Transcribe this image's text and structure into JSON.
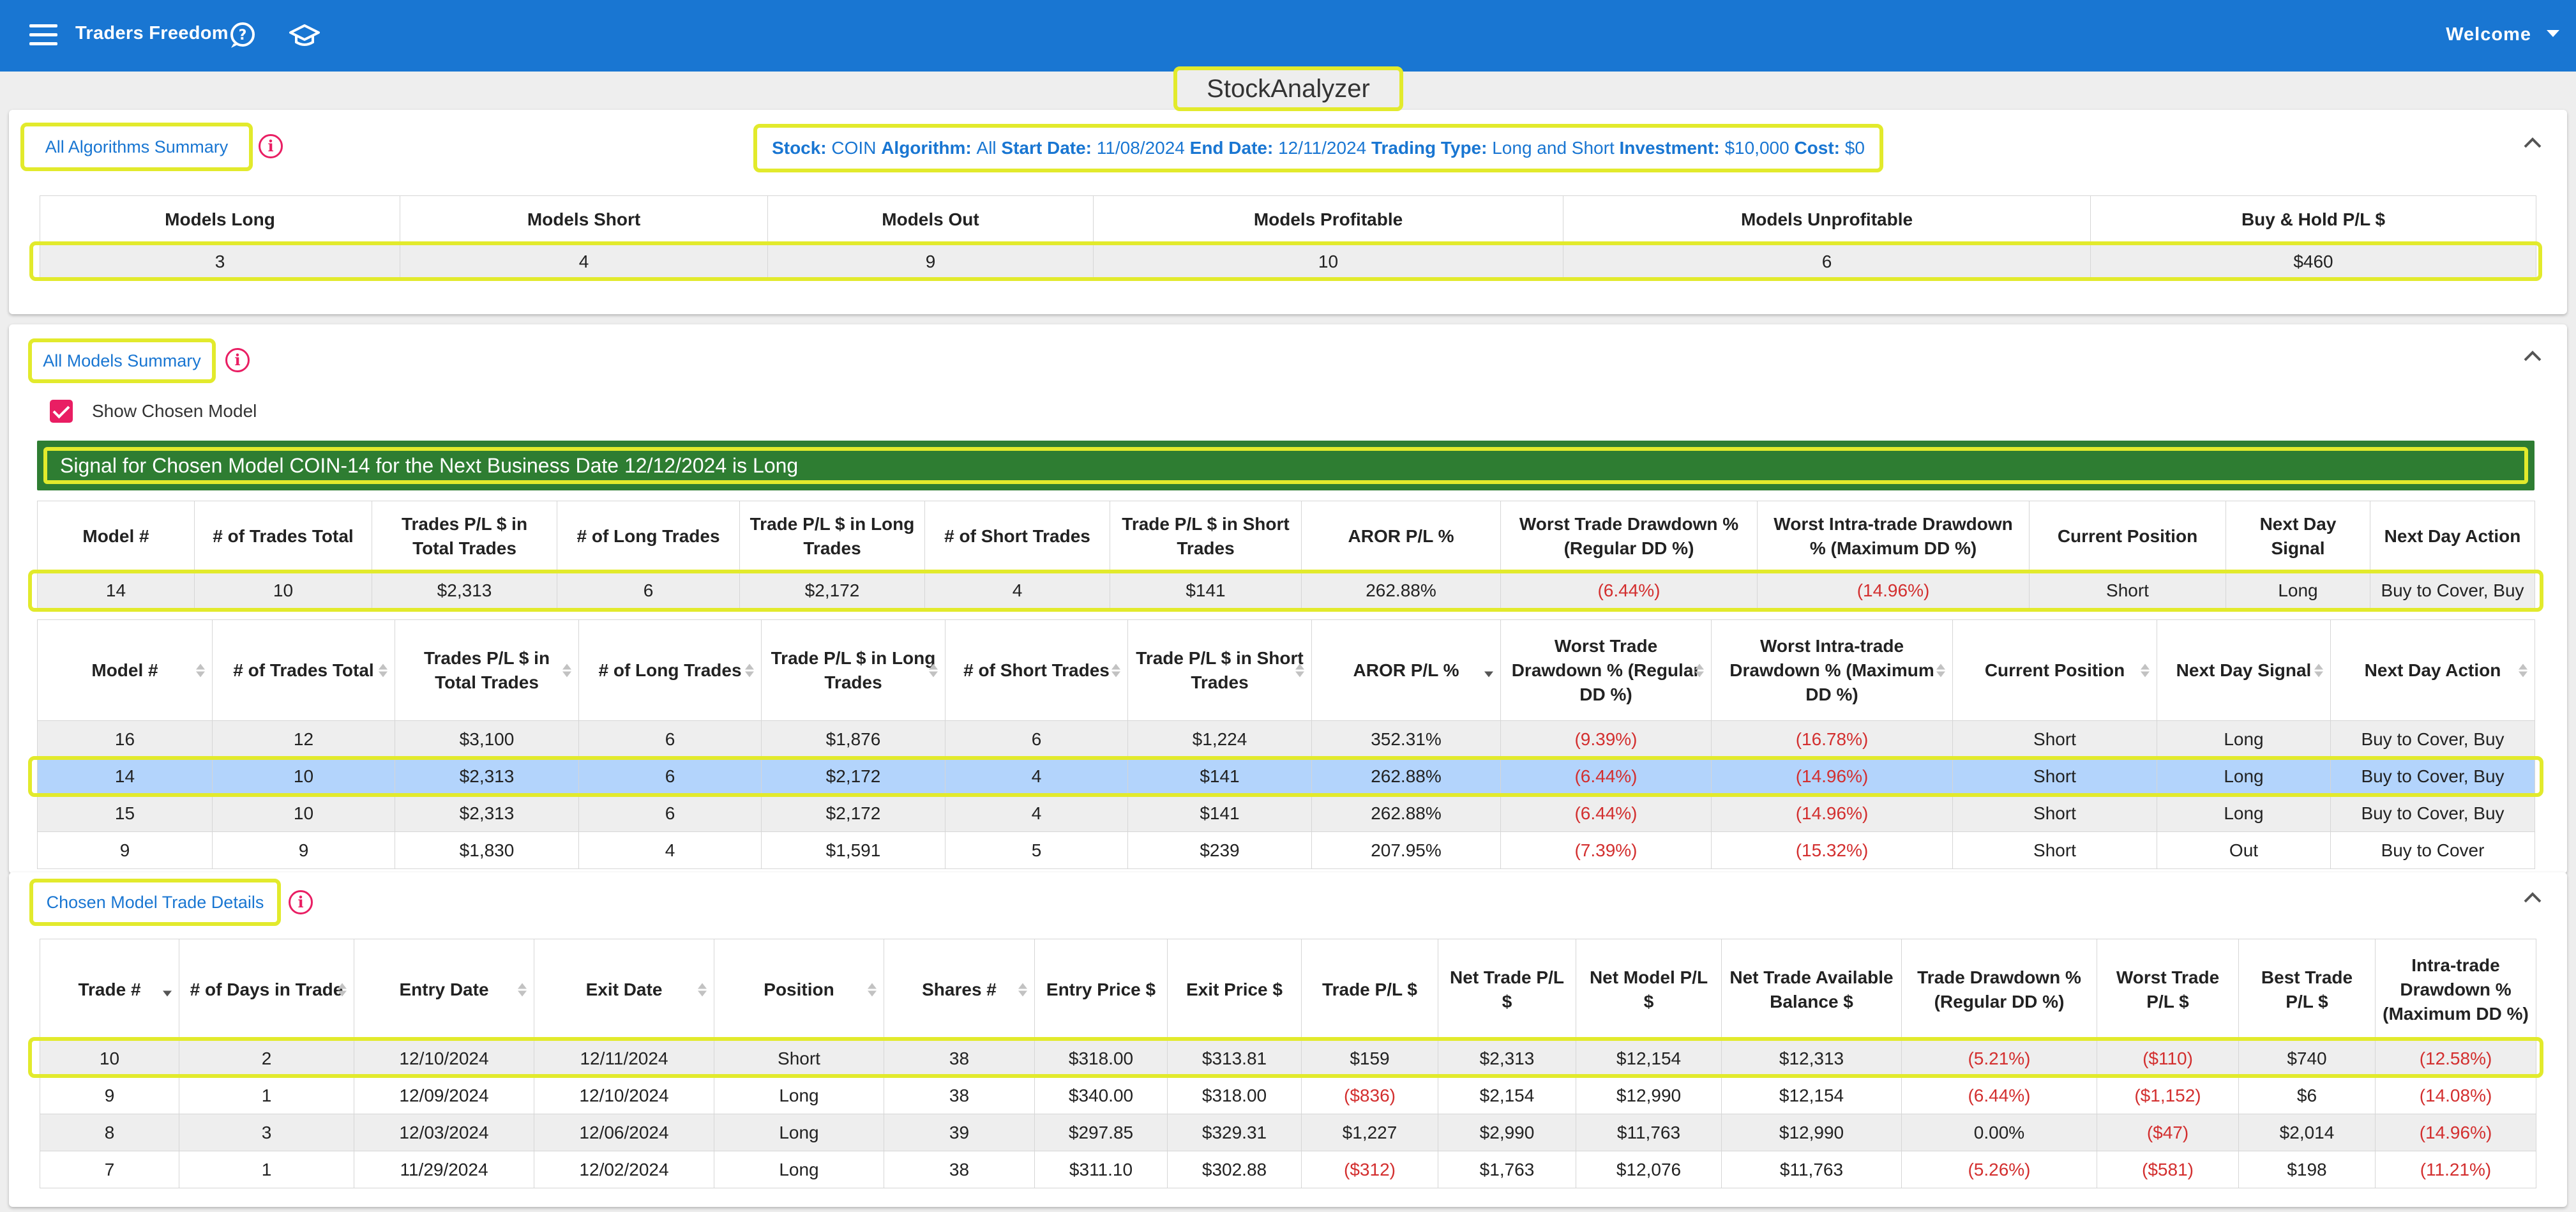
{
  "appbar": {
    "brand": "Traders Freedom",
    "welcome": "Welcome",
    "icons": [
      "menu-icon",
      "help-icon",
      "school-icon",
      "chevron-down-icon"
    ],
    "color": "#1976d2"
  },
  "page_title": "StockAnalyzer",
  "colors": {
    "highlight": "#e2ea2c",
    "negative": "#d32f2f",
    "signal": "#2e7d32",
    "selected_row": "#b3d4fc",
    "info": "#e91e63"
  },
  "algorithms_summary": {
    "button": "All Algorithms Summary",
    "params": [
      {
        "label": "Stock:",
        "value": "COIN"
      },
      {
        "label": "Algorithm:",
        "value": "All"
      },
      {
        "label": "Start Date:",
        "value": "11/08/2024"
      },
      {
        "label": "End Date:",
        "value": "12/11/2024"
      },
      {
        "label": "Trading Type:",
        "value": "Long and Short"
      },
      {
        "label": "Investment:",
        "value": "$10,000"
      },
      {
        "label": "Cost:",
        "value": "$0"
      }
    ],
    "headers": [
      "Models Long",
      "Models Short",
      "Models Out",
      "Models Profitable",
      "Models Unprofitable",
      "Buy & Hold P/L $"
    ],
    "values": [
      "3",
      "4",
      "9",
      "10",
      "6",
      "$460"
    ]
  },
  "models_summary": {
    "button": "All Models Summary",
    "show_chosen_label": "Show Chosen Model",
    "show_chosen_checked": true,
    "signal_text": "Signal for Chosen Model COIN-14 for the Next Business Date 12/12/2024 is Long",
    "chosen_headers": [
      "Model #",
      "# of Trades Total",
      "Trades P/L $ in Total Trades",
      "# of Long Trades",
      "Trade P/L $ in Long Trades",
      "# of Short Trades",
      "Trade P/L $ in Short Trades",
      "AROR P/L %",
      "Worst Trade Drawdown % (Regular DD %)",
      "Worst Intra-trade Drawdown % (Maximum DD %)",
      "Current Position",
      "Next Day Signal",
      "Next Day Action"
    ],
    "chosen_row": [
      "14",
      "10",
      "$2,313",
      "6",
      "$2,172",
      "4",
      "$141",
      "262.88%",
      "(6.44%)",
      "(14.96%)",
      "Short",
      "Long",
      "Buy to Cover, Buy"
    ],
    "list_headers": [
      "Model #",
      "# of Trades Total",
      "Trades P/L $ in Total Trades",
      "# of Long Trades",
      "Trade P/L $ in Long Trades",
      "# of Short Trades",
      "Trade P/L $ in Short Trades",
      "AROR P/L %",
      "Worst Trade Drawdown % (Regular DD %)",
      "Worst Intra-trade Drawdown % (Maximum DD %)",
      "Current Position",
      "Next Day Signal",
      "Next Day Action"
    ],
    "list_rows": [
      [
        "16",
        "12",
        "$3,100",
        "6",
        "$1,876",
        "6",
        "$1,224",
        "352.31%",
        "(9.39%)",
        "(16.78%)",
        "Short",
        "Long",
        "Buy to Cover, Buy"
      ],
      [
        "14",
        "10",
        "$2,313",
        "6",
        "$2,172",
        "4",
        "$141",
        "262.88%",
        "(6.44%)",
        "(14.96%)",
        "Short",
        "Long",
        "Buy to Cover, Buy"
      ],
      [
        "15",
        "10",
        "$2,313",
        "6",
        "$2,172",
        "4",
        "$141",
        "262.88%",
        "(6.44%)",
        "(14.96%)",
        "Short",
        "Long",
        "Buy to Cover, Buy"
      ],
      [
        "9",
        "9",
        "$1,830",
        "4",
        "$1,591",
        "5",
        "$239",
        "207.95%",
        "(7.39%)",
        "(15.32%)",
        "Short",
        "Out",
        "Buy to Cover"
      ]
    ],
    "sorted_column": "AROR P/L %",
    "selected_row_index": 1
  },
  "trade_details": {
    "button": "Chosen Model Trade Details",
    "headers": [
      "Trade #",
      "# of Days in Trade",
      "Entry Date",
      "Exit Date",
      "Position",
      "Shares #",
      "Entry Price $",
      "Exit Price $",
      "Trade P/L $",
      "Net Trade P/L $",
      "Net Model P/L $",
      "Net Trade Available Balance $",
      "Trade Drawdown % (Regular DD %)",
      "Worst Trade P/L $",
      "Best Trade P/L $",
      "Intra-trade Drawdown % (Maximum DD %)"
    ],
    "rows": [
      [
        "10",
        "2",
        "12/10/2024",
        "12/11/2024",
        "Short",
        "38",
        "$318.00",
        "$313.81",
        "$159",
        "$2,313",
        "$12,154",
        "$12,313",
        "(5.21%)",
        "($110)",
        "$740",
        "(12.58%)"
      ],
      [
        "9",
        "1",
        "12/09/2024",
        "12/10/2024",
        "Long",
        "38",
        "$340.00",
        "$318.00",
        "($836)",
        "$2,154",
        "$12,990",
        "$12,154",
        "(6.44%)",
        "($1,152)",
        "$6",
        "(14.08%)"
      ],
      [
        "8",
        "3",
        "12/03/2024",
        "12/06/2024",
        "Long",
        "39",
        "$297.85",
        "$329.31",
        "$1,227",
        "$2,990",
        "$11,763",
        "$12,990",
        "0.00%",
        "($47)",
        "$2,014",
        "(14.96%)"
      ],
      [
        "7",
        "1",
        "11/29/2024",
        "12/02/2024",
        "Long",
        "38",
        "$311.10",
        "$302.88",
        "($312)",
        "$1,763",
        "$12,076",
        "$11,763",
        "(5.26%)",
        "($581)",
        "$198",
        "(11.21%)"
      ]
    ],
    "sorted_column": "Trade #"
  }
}
